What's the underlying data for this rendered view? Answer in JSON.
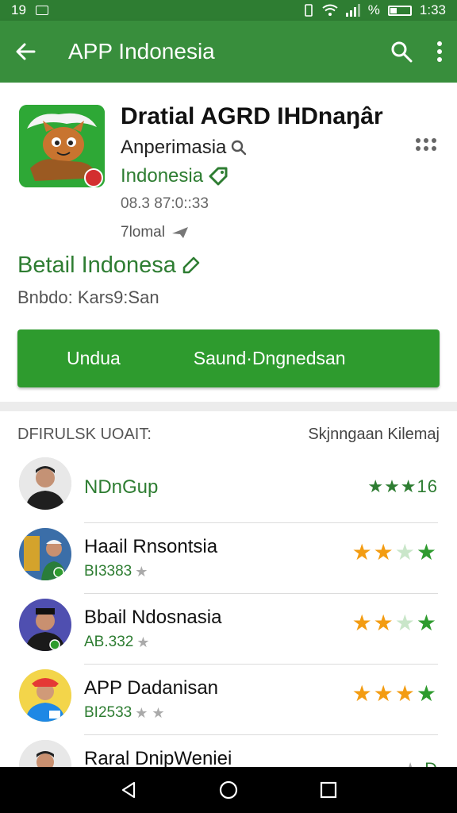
{
  "status": {
    "time_left": "19",
    "time_right": "1:33",
    "percent": "%"
  },
  "appbar": {
    "title": "APP Indonesia"
  },
  "app": {
    "name": "Dratial AGRD IHDnaŋâr",
    "developer": "Anperimasia",
    "category": "Indonesia",
    "date": "08.3 87:0::33",
    "size": "7lomal"
  },
  "detail": {
    "title": "Betail Indonesa",
    "subtitle": "Bnbdo: Kars9:San"
  },
  "install": {
    "left_label": "Undua",
    "right_label": "Saund·Dngnedsan"
  },
  "reviews": {
    "header_left": "DFIRULSK UOAIT:",
    "header_right": "Skjnngaan Kilemaj",
    "items": [
      {
        "name": "NDnGup",
        "meta": "",
        "rating_text": "★★★16"
      },
      {
        "name": "Haail Rnsontsia",
        "meta": "BI3383"
      },
      {
        "name": "Bbail Ndosnasia",
        "meta": "AB.332"
      },
      {
        "name": "APP Dadanisan",
        "meta": "BI2533"
      },
      {
        "name": "Raral DnipWeniei",
        "meta": "",
        "rating_text": "D"
      }
    ]
  },
  "colors": {
    "primary": "#388e3c",
    "status": "#2e7d32",
    "button": "#2e9b2e",
    "star_orange": "#f39c12"
  }
}
